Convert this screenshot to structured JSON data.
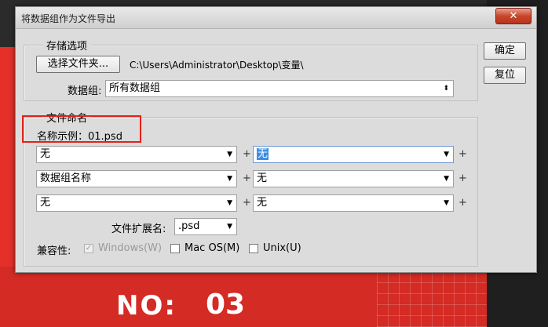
{
  "dialog": {
    "title": "将数据组作为文件导出",
    "close_label": "✕",
    "buttons": {
      "ok": "确定",
      "reset": "复位"
    },
    "storage": {
      "group_label": "存储选项",
      "choose_folder_label": "选择文件夹...",
      "folder_path": "C:\\Users\\Administrator\\Desktop\\变量\\",
      "dataset_label": "数据组:",
      "dataset_value": "所有数据组"
    },
    "naming": {
      "group_label": "文件命名",
      "example_label": "名称示例：01.psd",
      "rows": [
        {
          "left": "无",
          "right": "无"
        },
        {
          "left": "数据组名称",
          "right": "无"
        },
        {
          "left": "无",
          "right": "无"
        }
      ],
      "plus": "+",
      "extension_label": "文件扩展名:",
      "extension_value": ".psd",
      "compat_label": "兼容性:",
      "compat_windows": "Windows(W)",
      "compat_mac": "Mac OS(M)",
      "compat_unix": "Unix(U)"
    }
  },
  "background": {
    "no_label": "NO:",
    "number": "03"
  },
  "colors": {
    "accent_red": "#e5302a",
    "highlight_blue": "#3b8ee6"
  }
}
